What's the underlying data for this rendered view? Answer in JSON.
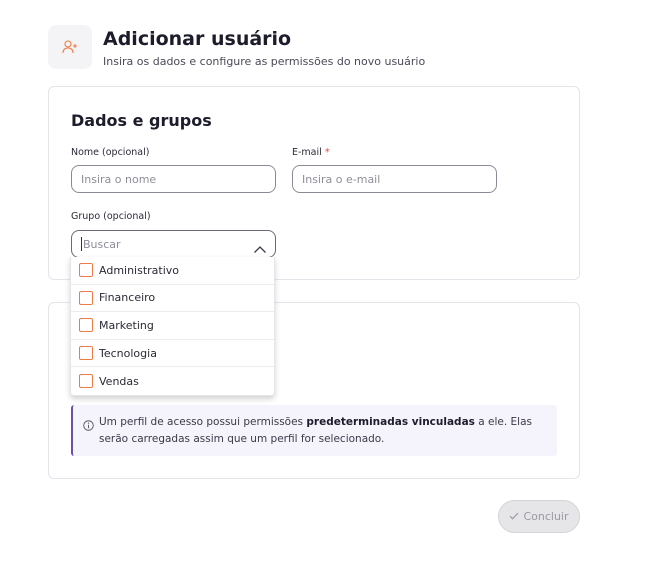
{
  "header": {
    "title": "Adicionar usuário",
    "subtitle": "Insira os dados e configure as permissões do novo usuário"
  },
  "section": {
    "title": "Dados e grupos"
  },
  "fields": {
    "name_label": "Nome (opcional)",
    "name_placeholder": "Insira o nome",
    "email_label": "E-mail",
    "email_required": "*",
    "email_placeholder": "Insira o e-mail",
    "group_label": "Grupo (opcional)",
    "group_placeholder": "Buscar"
  },
  "groups": [
    {
      "label": "Administrativo",
      "checked": false
    },
    {
      "label": "Financeiro",
      "checked": false
    },
    {
      "label": "Marketing",
      "checked": false
    },
    {
      "label": "Tecnologia",
      "checked": false
    },
    {
      "label": "Vendas",
      "checked": false
    }
  ],
  "info": {
    "text_before": "Um perfil de acesso possui permissões ",
    "text_bold": "predeterminadas vinculadas",
    "text_after": " a ele. Elas serão carregadas assim que um perfil for selecionado."
  },
  "actions": {
    "submit_label": "Concluir"
  },
  "colors": {
    "accent": "#ee7a45",
    "info_border": "#6b4fa8",
    "required": "#e2453a"
  },
  "icons": {
    "header": "user-add-icon",
    "info": "info-icon",
    "dropdown": "chevron-up-icon",
    "submit": "check-icon"
  }
}
